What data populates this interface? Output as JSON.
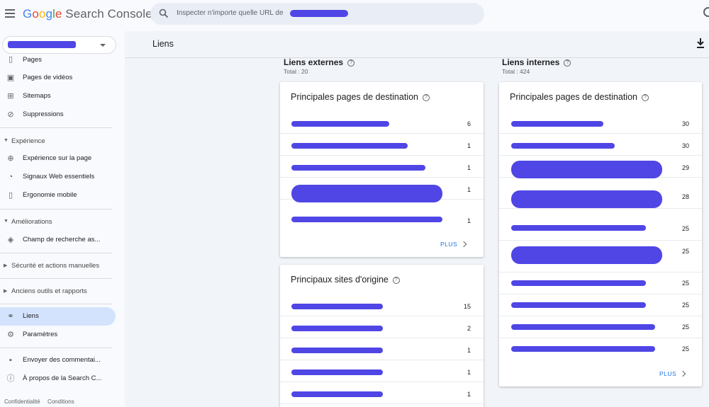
{
  "app": {
    "title_parts": [
      "G",
      "o",
      "o",
      "g",
      "l",
      "e"
    ],
    "title_rest": " Search Console"
  },
  "search": {
    "placeholder": "Inspecter n'importe quelle URL de"
  },
  "sidebar": {
    "items_top": [
      {
        "label": "Pages",
        "icon": "pages-icon"
      },
      {
        "label": "Pages de vidéos",
        "icon": "video-pages-icon"
      },
      {
        "label": "Sitemaps",
        "icon": "sitemap-icon"
      },
      {
        "label": "Suppressions",
        "icon": "removals-icon"
      }
    ],
    "section_experience": "Expérience",
    "items_experience": [
      {
        "label": "Expérience sur la page",
        "icon": "page-experience-icon"
      },
      {
        "label": "Signaux Web essentiels",
        "icon": "gauge-icon"
      },
      {
        "label": "Ergonomie mobile",
        "icon": "mobile-icon"
      }
    ],
    "section_ameliorations": "Améliorations",
    "items_ameliorations": [
      {
        "label": "Champ de recherche as...",
        "icon": "layers-icon"
      }
    ],
    "section_securite": "Sécurité et actions manuelles",
    "section_anciens": "Anciens outils et rapports",
    "item_liens": "Liens",
    "item_parametres": "Paramètres",
    "item_feedback": "Envoyer des commentai...",
    "item_about": "À propos de la Search C...",
    "footer": {
      "privacy": "Confidentialité",
      "terms": "Conditions"
    }
  },
  "main": {
    "title": "Liens",
    "external": {
      "heading": "Liens externes",
      "total": "Total : 20",
      "top_pages": {
        "title": "Principales pages de destination",
        "values": [
          "6",
          "1",
          "1",
          "1",
          "1"
        ],
        "more": "PLUS"
      },
      "top_sites": {
        "title": "Principaux sites d'origine",
        "values": [
          "15",
          "2",
          "1",
          "1",
          "1"
        ]
      }
    },
    "internal": {
      "heading": "Liens internes",
      "total": "Total : 424",
      "top_pages": {
        "title": "Principales pages de destination",
        "values": [
          "30",
          "30",
          "29",
          "28",
          "25",
          "25",
          "25",
          "25",
          "25",
          "25"
        ],
        "more": "PLUS"
      }
    }
  },
  "colors": {
    "redaction": "#4f46e5",
    "accent": "#1a73e8",
    "active_nav": "#d3e3fd"
  }
}
